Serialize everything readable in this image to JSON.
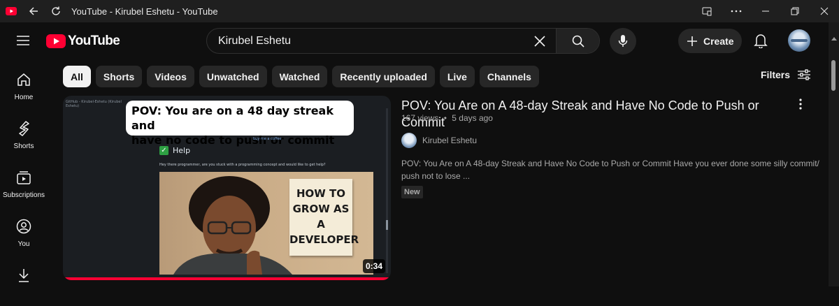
{
  "window": {
    "title": "YouTube - Kirubel Eshetu - YouTube",
    "controls": [
      "cast-icon",
      "more-icon",
      "minimize-icon",
      "restore-icon",
      "close-icon"
    ]
  },
  "header": {
    "logo_text": "YouTube",
    "search": {
      "value": "Kirubel Eshetu",
      "placeholder": "Search"
    },
    "create_label": "Create"
  },
  "sidebar": {
    "items": [
      {
        "label": "Home",
        "icon": "home-icon"
      },
      {
        "label": "Shorts",
        "icon": "shorts-icon"
      },
      {
        "label": "Subscriptions",
        "icon": "subscriptions-icon"
      },
      {
        "label": "You",
        "icon": "you-icon"
      },
      {
        "label": "",
        "icon": "download-icon"
      }
    ]
  },
  "chips": [
    {
      "label": "All",
      "active": true
    },
    {
      "label": "Shorts"
    },
    {
      "label": "Videos"
    },
    {
      "label": "Unwatched"
    },
    {
      "label": "Watched"
    },
    {
      "label": "Recently uploaded"
    },
    {
      "label": "Live"
    },
    {
      "label": "Channels"
    }
  ],
  "filters_label": "Filters",
  "video": {
    "title": "POV: You Are on A 48-day Streak and Have No Code to Push or Commit",
    "views": "167 views",
    "separator": "•",
    "age": "5 days ago",
    "channel": "Kirubel Eshetu",
    "description": "POV: You Are on A 48-day Streak and Have No Code to Push or Commit Have you ever done some silly commit/ push not to lose ...",
    "badge": "New",
    "duration": "0:34",
    "watched_fraction": 1.0,
    "thumbnail": {
      "bubble_line1": "POV: You are on a 48 day streak and",
      "bubble_line2": "have no code to push or commit",
      "browser_tab": "GitHub - Kirubel-Eshetu (Kirubel Eshetu)",
      "link_text": "buy me a coffee",
      "help_heading": "Help",
      "help_text": "Hey there programmer, are you stuck with a programming concept and would like to get help?",
      "note_line1": "HOW TO",
      "note_line2": "GROW AS",
      "note_line3": "A",
      "note_line4": "DEVELOPER"
    }
  },
  "colors": {
    "background": "#0f0f0f",
    "accent": "#ff0033",
    "chip": "#272727"
  }
}
